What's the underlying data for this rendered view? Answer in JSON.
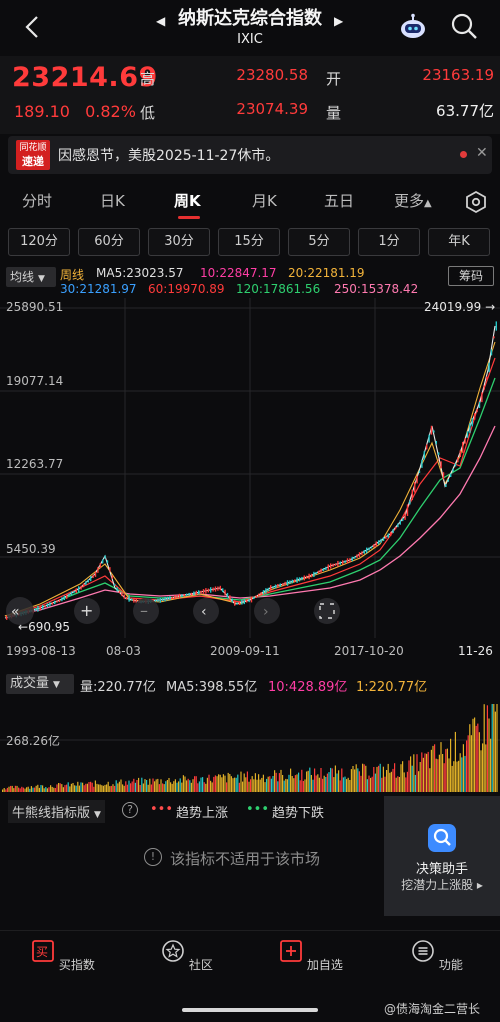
{
  "header": {
    "title": "纳斯达克综合指数",
    "subtitle": "IXIC"
  },
  "quote": {
    "price": "23214.69",
    "change": "189.10",
    "change_pct": "0.82%",
    "high_label": "高",
    "high": "23280.58",
    "open_label": "开",
    "open": "23163.19",
    "low_label": "低",
    "low": "23074.39",
    "volume_label": "量",
    "volume": "63.77亿"
  },
  "notice": {
    "logo_line1": "同花顺",
    "logo_line2": "速递",
    "text": "因感恩节，美股2025-11-27休市。"
  },
  "tabs": [
    "分时",
    "日K",
    "周K",
    "月K",
    "五日",
    "更多"
  ],
  "active_tab": "周K",
  "minute_buttons": [
    "120分",
    "60分",
    "30分",
    "15分",
    "5分",
    "1分",
    "年K"
  ],
  "ma": {
    "selector": "均线",
    "period": "周线",
    "ma5": "MA5:23023.57",
    "ma10": "10:22847.17",
    "ma20": "20:22181.19",
    "ma30": "30:21281.97",
    "ma60": "60:19970.89",
    "ma120": "120:17861.56",
    "ma250": "250:15378.42",
    "chouma": "筹码",
    "colors": {
      "ma5": "#e0e0e0",
      "ma10": "#ff3ea5",
      "ma20": "#f2b33a",
      "ma30": "#3aa0ff",
      "ma60": "#ff3b3b",
      "ma120": "#2ecf6f",
      "ma250": "#ff7ab0"
    }
  },
  "chart": {
    "y_labels": [
      "25890.51",
      "19077.14",
      "12263.77",
      "5450.39"
    ],
    "high_marker": "24019.99",
    "low_marker": "690.95",
    "low_marker_prefix": "←",
    "dates": [
      "1993-08-13",
      "08-03",
      "2009-09-11",
      "2017-10-20",
      "11-26"
    ]
  },
  "volume": {
    "selector": "成交量",
    "vol": "量:220.77亿",
    "ma5": "MA5:398.55亿",
    "ma10": "10:428.89亿",
    "ma1": "1:220.77亿",
    "y_label": "268.26亿"
  },
  "indicator": {
    "selector": "牛熊线指标版",
    "help": "?",
    "up_label": "趋势上涨",
    "down_label": "趋势下跌",
    "message": "该指标不适用于该市场",
    "decision_title": "决策助手",
    "decision_sub": "挖潜力上涨股 ▸"
  },
  "bottom_nav": [
    {
      "label": "买指数",
      "icon": "buy-icon"
    },
    {
      "label": "社区",
      "icon": "community-icon"
    },
    {
      "label": "加自选",
      "icon": "add-watchlist-icon"
    },
    {
      "label": "功能",
      "icon": "menu-icon"
    }
  ],
  "watermark": "@债海淘金二营长"
}
